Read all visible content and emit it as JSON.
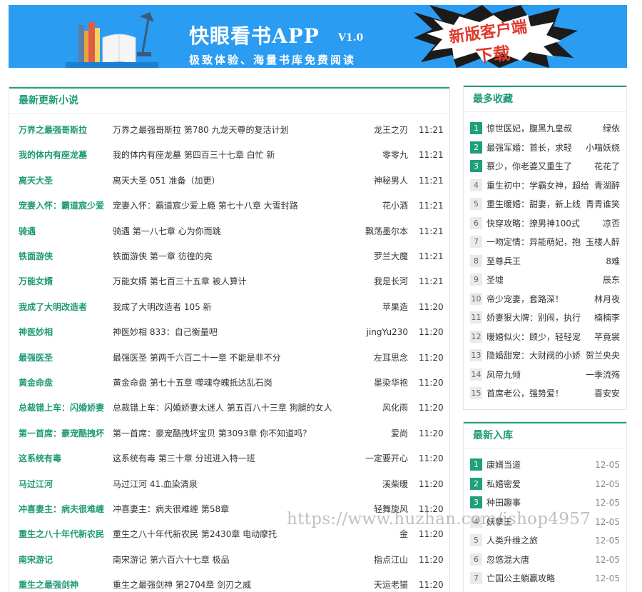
{
  "banner": {
    "title": "快眼看书APP",
    "version": "V1.0",
    "slogan": "极致体验、海量书库免费阅读",
    "download_line1": "新版客户端",
    "download_line2": "下载"
  },
  "latest": {
    "heading": "最新更新小说",
    "rows": [
      {
        "name": "万界之最强哥斯拉",
        "chapter": "万界之最强哥斯拉 第780 九龙天尊的复活计划",
        "author": "龙王之刃",
        "time": "11:21"
      },
      {
        "name": "我的体内有座龙墓",
        "chapter": "我的体内有座龙墓 第四百三十七章 白忙 新",
        "author": "零零九",
        "time": "11:21"
      },
      {
        "name": "离天大圣",
        "chapter": "离天大圣 051 准备（加更）",
        "author": "神秘男人",
        "time": "11:21"
      },
      {
        "name": "宠妻入怀：霸道宸少爱",
        "chapter": "宠妻入怀：霸道宸少爱上瘾 第七十八章 大雪封路",
        "author": "花小酒",
        "time": "11:21"
      },
      {
        "name": "骑遇",
        "chapter": "骑遇 第一八七章 心为你而跳",
        "author": "飘荡墨尔本",
        "time": "11:21"
      },
      {
        "name": "铁面游侠",
        "chapter": "铁面游侠 第一章 彷徨的亮",
        "author": "罗兰大魔",
        "time": "11:21"
      },
      {
        "name": "万能女婿",
        "chapter": "万能女婿 第七百三十五章 被人算计",
        "author": "我是长河",
        "time": "11:21"
      },
      {
        "name": "我成了大明改造者",
        "chapter": "我成了大明改造者 105 新",
        "author": "苹果造",
        "time": "11:20"
      },
      {
        "name": "神医妙相",
        "chapter": "神医妙相 833：自己衡量吧",
        "author": "jingYu230",
        "time": "11:20"
      },
      {
        "name": "最强医圣",
        "chapter": "最强医圣 第两千六百二十一章 不能是非不分",
        "author": "左耳思念",
        "time": "11:20"
      },
      {
        "name": "黄金命盘",
        "chapter": "黄金命盘 第七十五章 噬魂夺魄抵达乱石岗",
        "author": "墨染华袍",
        "time": "11:20"
      },
      {
        "name": "总裁错上车：闪婚娇妻",
        "chapter": "总裁错上车：闪婚娇妻太迷人 第五百八十三章 狗腿的女人",
        "author": "风化雨",
        "time": "11:20"
      },
      {
        "name": "第一首席：豪宠酷拽坏",
        "chapter": "第一首席：豪宠酷拽坏宝贝 第3093章 你不知道吗？",
        "author": "爱尚",
        "time": "11:20"
      },
      {
        "name": "这系统有毒",
        "chapter": "这系统有毒 第三十章 分班进入特一班",
        "author": "一定要开心",
        "time": "11:20"
      },
      {
        "name": "马过江河",
        "chapter": "马过江河 41.血染清泉",
        "author": "溪柴暖",
        "time": "11:20"
      },
      {
        "name": "冲喜妻主：病夫很难缠",
        "chapter": "冲喜妻主：病夫很难缠 第58章",
        "author": "轻舞旋风",
        "time": "11:20"
      },
      {
        "name": "重生之八十年代新农民",
        "chapter": "重生之八十年代新农民 第2430章 电动摩托",
        "author": "金",
        "time": "11:20"
      },
      {
        "name": "南宋游记",
        "chapter": "南宋游记 第六百六十七章 极品",
        "author": "指点江山",
        "time": "11:20"
      },
      {
        "name": "重生之最强剑神",
        "chapter": "重生之最强剑神 第2704章 剑刃之威",
        "author": "天运老猫",
        "time": "11:20"
      }
    ]
  },
  "most_collected": {
    "heading": "最多收藏",
    "rows": [
      {
        "num": "1",
        "title": "惊世医妃，腹黑九皇叔",
        "author": "绿依"
      },
      {
        "num": "2",
        "title": "最强军婚：首长，求轻",
        "author": "小喵妖娆"
      },
      {
        "num": "3",
        "title": "慕少，你老婆又重生了",
        "author": "花花了"
      },
      {
        "num": "4",
        "title": "重生初中：学霸女神，超给",
        "author": "青湖醉"
      },
      {
        "num": "5",
        "title": "重生暖婚：甜妻，新上线",
        "author": "青青谁笑"
      },
      {
        "num": "6",
        "title": "快穿攻略：撩男神100式",
        "author": "凉否"
      },
      {
        "num": "7",
        "title": "一吻定情：异能萌妃，抱",
        "author": "玉楼人醉"
      },
      {
        "num": "8",
        "title": "至尊兵王",
        "author": "8难"
      },
      {
        "num": "9",
        "title": "圣墟",
        "author": "辰东"
      },
      {
        "num": "10",
        "title": "帝少宠妻，套路深！",
        "author": "林月夜"
      },
      {
        "num": "11",
        "title": "娇妻狠大牌：别闹，执行",
        "author": "楠楠李"
      },
      {
        "num": "12",
        "title": "暖婚似火：顾少，轻轻宠",
        "author": "芊竟裳"
      },
      {
        "num": "13",
        "title": "隐婚甜宠：大财阀的小娇",
        "author": "贺兰央央"
      },
      {
        "num": "14",
        "title": "凤帝九倾",
        "author": "一季流殇"
      },
      {
        "num": "15",
        "title": "首席老公，强势爱！",
        "author": "喜安安"
      }
    ]
  },
  "new_books": {
    "heading": "最新入库",
    "rows": [
      {
        "num": "1",
        "title": "康婿当道",
        "date": "12-05"
      },
      {
        "num": "2",
        "title": "私婚密爱",
        "date": "12-05"
      },
      {
        "num": "3",
        "title": "种田趣事",
        "date": "12-05"
      },
      {
        "num": "4",
        "title": "妖孽王",
        "date": "12-05"
      },
      {
        "num": "5",
        "title": "人类升维之旅",
        "date": "12-05"
      },
      {
        "num": "6",
        "title": "忽悠混大唐",
        "date": "12-05"
      },
      {
        "num": "7",
        "title": "亡国公主躺赢攻略",
        "date": "12-05"
      }
    ]
  },
  "watermark": "https://www.huzhan.com/ishop4957"
}
